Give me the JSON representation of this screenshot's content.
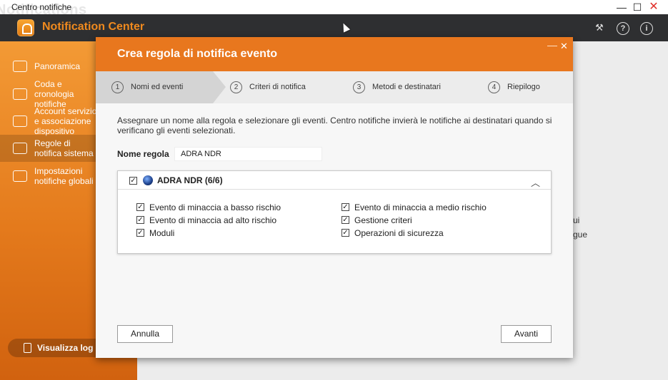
{
  "os_window": {
    "title": "Centro notifiche",
    "ghost_title": "Notifications"
  },
  "app": {
    "name": "Notification Center"
  },
  "sidebar": {
    "items": [
      {
        "label": "Panoramica"
      },
      {
        "label": "Coda e cronologia notifiche"
      },
      {
        "label": "Account servizio e associazione dispositivo"
      },
      {
        "label": "Regole di notifica sistema"
      },
      {
        "label": "Impostazioni notifiche globali"
      }
    ],
    "bottom_button": "Visualizza log e"
  },
  "background": {
    "text1": "ui",
    "text2": "gue"
  },
  "modal": {
    "title": "Crea regola di notifica evento",
    "steps": [
      {
        "num": "1",
        "label": "Nomi ed eventi"
      },
      {
        "num": "2",
        "label": "Criteri di notifica"
      },
      {
        "num": "3",
        "label": "Metodi e destinatari"
      },
      {
        "num": "4",
        "label": "Riepilogo"
      }
    ],
    "description": "Assegnare un nome alla regola e selezionare gli eventi. Centro notifiche invierà le notifiche ai destinatari quando si verificano gli eventi selezionati.",
    "rule_name_label": "Nome regola",
    "rule_name_value": "ADRA NDR",
    "events_group": {
      "title": "ADRA NDR (6/6)",
      "events": [
        {
          "label": "Evento di minaccia a basso rischio",
          "checked": true
        },
        {
          "label": "Evento di minaccia a medio rischio",
          "checked": true
        },
        {
          "label": "Evento di minaccia ad alto rischio",
          "checked": true
        },
        {
          "label": "Gestione criteri",
          "checked": true
        },
        {
          "label": "Moduli",
          "checked": true
        },
        {
          "label": "Operazioni di sicurezza",
          "checked": true
        }
      ]
    },
    "cancel_label": "Annulla",
    "next_label": "Avanti"
  },
  "colors": {
    "accent": "#e8771e",
    "header_bg": "#2e2f31",
    "brand_text": "#f08a1e"
  },
  "icons": [
    "app-logo-icon",
    "magic-wand-icon",
    "help-icon",
    "info-icon",
    "chevron-up-icon",
    "checkbox-icon",
    "log-icon"
  ]
}
